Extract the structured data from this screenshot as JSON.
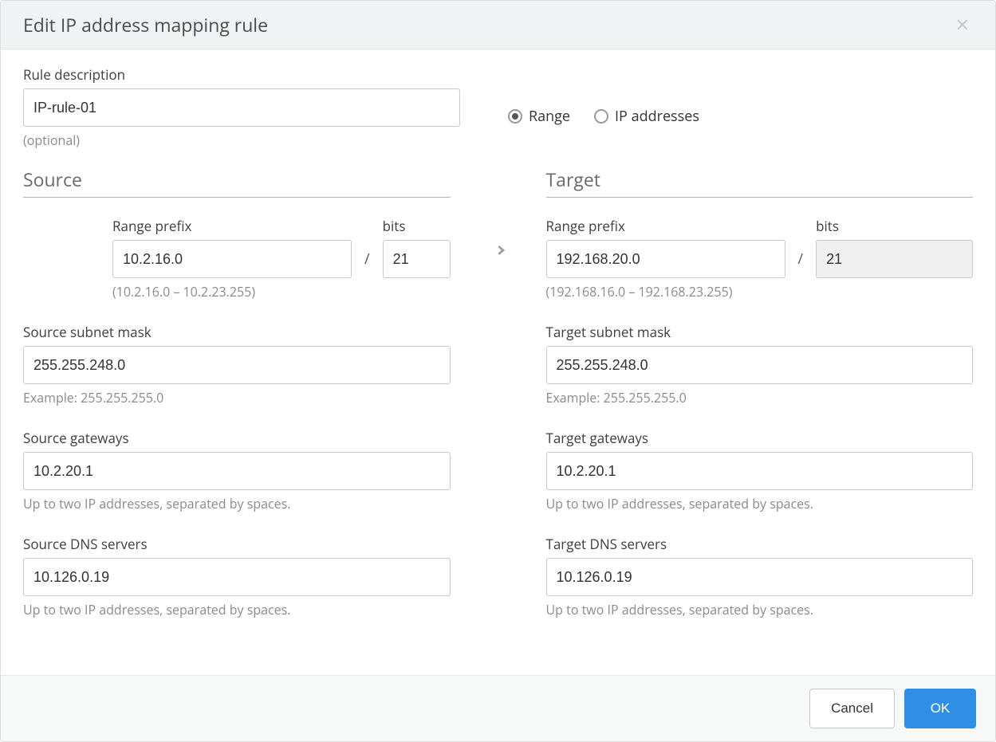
{
  "dialog": {
    "title": "Edit IP address mapping rule",
    "close": "✕"
  },
  "ruleDescription": {
    "label": "Rule description",
    "value": "IP-rule-01",
    "hint": "(optional)"
  },
  "mode": {
    "range": "Range",
    "ip": "IP addresses",
    "selected": "range"
  },
  "source": {
    "title": "Source",
    "rangePrefixLabel": "Range prefix",
    "rangePrefixValue": "10.2.16.0",
    "bitsLabel": "bits",
    "bitsValue": "21",
    "rangeHint": "(10.2.16.0 – 10.2.23.255)",
    "subnetLabel": "Source subnet mask",
    "subnetValue": "255.255.248.0",
    "subnetHint": "Example: 255.255.255.0",
    "gatewaysLabel": "Source gateways",
    "gatewaysValue": "10.2.20.1",
    "gatewaysHint": "Up to two IP addresses, separated by spaces.",
    "dnsLabel": "Source DNS servers",
    "dnsValue": "10.126.0.19",
    "dnsHint": "Up to two IP addresses, separated by spaces."
  },
  "target": {
    "title": "Target",
    "rangePrefixLabel": "Range prefix",
    "rangePrefixValue": "192.168.20.0",
    "bitsLabel": "bits",
    "bitsValue": "21",
    "rangeHint": "(192.168.16.0 – 192.168.23.255)",
    "subnetLabel": "Target subnet mask",
    "subnetValue": "255.255.248.0",
    "subnetHint": "Example: 255.255.255.0",
    "gatewaysLabel": "Target gateways",
    "gatewaysValue": "10.2.20.1",
    "gatewaysHint": "Up to two IP addresses, separated by spaces.",
    "dnsLabel": "Target DNS servers",
    "dnsValue": "10.126.0.19",
    "dnsHint": "Up to two IP addresses, separated by spaces."
  },
  "footer": {
    "cancel": "Cancel",
    "ok": "OK"
  }
}
